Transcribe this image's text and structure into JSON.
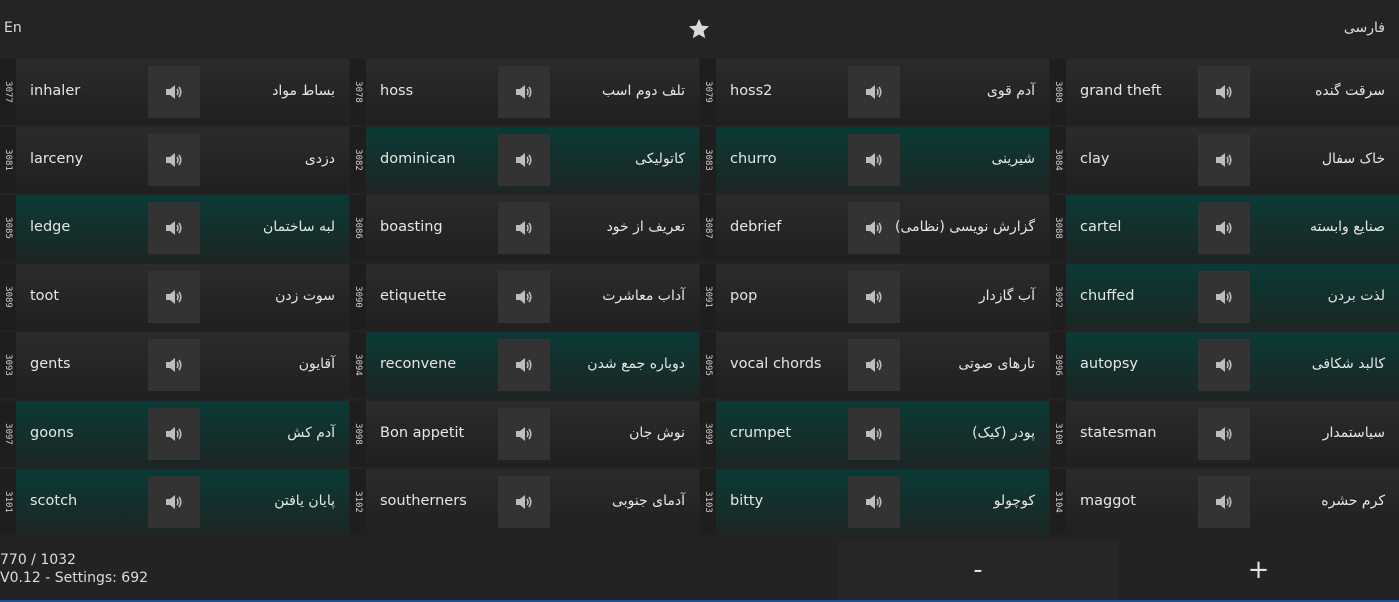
{
  "header": {
    "lang_left": "En",
    "lang_right": "فارسی",
    "favorite_icon": "star-icon"
  },
  "cards": [
    [
      {
        "num": "3077",
        "en": "inhaler",
        "fa": "بساط مواد",
        "teal": false
      },
      {
        "num": "3078",
        "en": "hoss",
        "fa": "تلف دوم اسب",
        "teal": false
      },
      {
        "num": "3079",
        "en": "hoss2",
        "fa": "آدم قوی",
        "teal": false
      },
      {
        "num": "3080",
        "en": "grand theft",
        "fa": "سرقت گنده",
        "teal": false
      }
    ],
    [
      {
        "num": "3081",
        "en": "larceny",
        "fa": "دزدی",
        "teal": false
      },
      {
        "num": "3082",
        "en": "dominican",
        "fa": "کاتولیکی",
        "teal": true
      },
      {
        "num": "3083",
        "en": "churro",
        "fa": "شیرینی",
        "teal": true
      },
      {
        "num": "3084",
        "en": "clay",
        "fa": "خاک سفال",
        "teal": false
      }
    ],
    [
      {
        "num": "3085",
        "en": "ledge",
        "fa": "لبه ساختمان",
        "teal": true
      },
      {
        "num": "3086",
        "en": "boasting",
        "fa": "تعریف از خود",
        "teal": false
      },
      {
        "num": "3087",
        "en": "debrief",
        "fa": "گزارش نویسی (نظامی)",
        "teal": false
      },
      {
        "num": "3088",
        "en": "cartel",
        "fa": "صنایع وابسته",
        "teal": true
      }
    ],
    [
      {
        "num": "3089",
        "en": "toot",
        "fa": "سوت زدن",
        "teal": false
      },
      {
        "num": "3090",
        "en": "etiquette",
        "fa": "آداب معاشرت",
        "teal": false
      },
      {
        "num": "3091",
        "en": "pop",
        "fa": "آب گازدار",
        "teal": false
      },
      {
        "num": "3092",
        "en": "chuffed",
        "fa": "لذت بردن",
        "teal": true
      }
    ],
    [
      {
        "num": "3093",
        "en": "gents",
        "fa": "آقایون",
        "teal": false
      },
      {
        "num": "3094",
        "en": "reconvene",
        "fa": "دوباره جمع شدن",
        "teal": true
      },
      {
        "num": "3095",
        "en": "vocal chords",
        "fa": "تارهای صوتی",
        "teal": false
      },
      {
        "num": "3096",
        "en": "autopsy",
        "fa": "کالبد شکافی",
        "teal": true
      }
    ],
    [
      {
        "num": "3097",
        "en": "goons",
        "fa": "آدم کش",
        "teal": true
      },
      {
        "num": "3098",
        "en": "Bon appetit",
        "fa": "نوش جان",
        "teal": false
      },
      {
        "num": "3099",
        "en": "crumpet",
        "fa": "پودر (کیک)",
        "teal": true
      },
      {
        "num": "3100",
        "en": "statesman",
        "fa": "سیاستمدار",
        "teal": false
      }
    ],
    [
      {
        "num": "3101",
        "en": "scotch",
        "fa": "پایان یافتن",
        "teal": true
      },
      {
        "num": "3102",
        "en": "southerners",
        "fa": "آدمای جنوبی",
        "teal": false
      },
      {
        "num": "3103",
        "en": "bitty",
        "fa": "کوچولو",
        "teal": true
      },
      {
        "num": "3104",
        "en": "maggot",
        "fa": "کرم حشره",
        "teal": false
      }
    ]
  ],
  "speaker_icon": "speaker-icon",
  "footer": {
    "count": "770 / 1032",
    "version": "V0.12 - Settings: 692",
    "minus_label": "-",
    "plus_label": "+"
  }
}
